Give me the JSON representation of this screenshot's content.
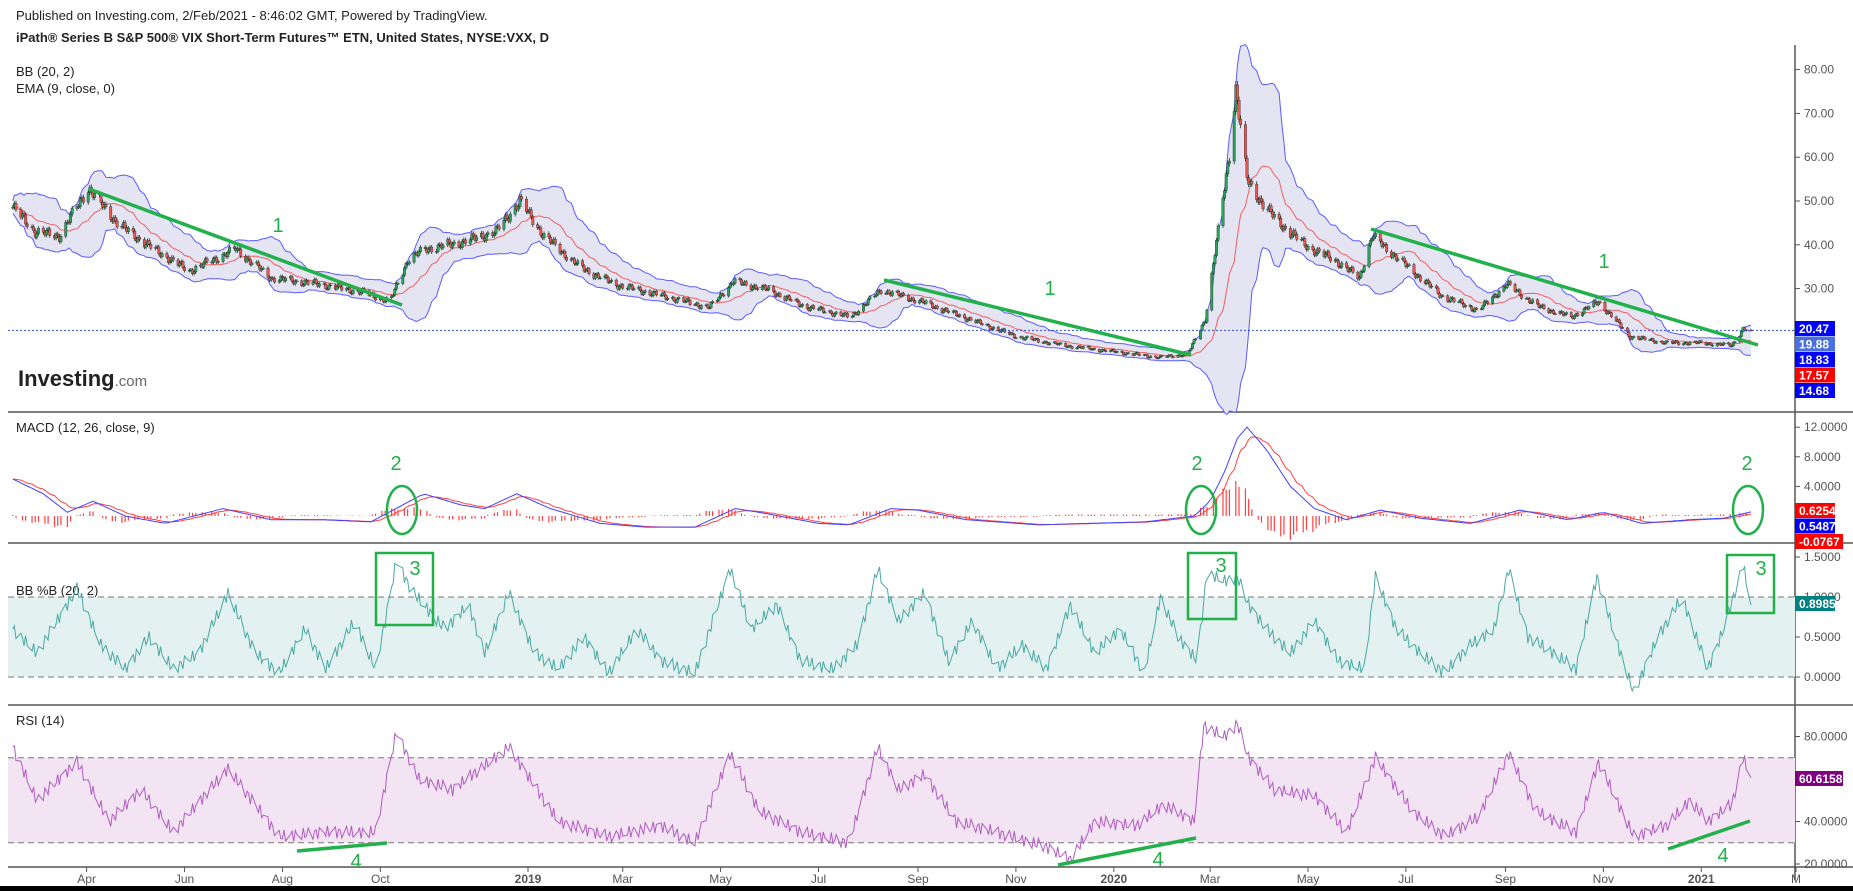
{
  "header": {
    "published": "Published on Investing.com, 2/Feb/2021 - 8:46:02 GMT, Powered by TradingView.",
    "title": "iPath® Series B S&P 500® VIX Short-Term Futures™ ETN, United States, NYSE:VXX, D"
  },
  "logo": {
    "main": "Investing",
    "suffix": ".com"
  },
  "colors": {
    "up": "#26a65b",
    "down": "#ef5350",
    "band": "#5b5bff",
    "bandFill": "#e4e4f3",
    "ema": "#f06060",
    "macd": "#4040ff",
    "signal": "#ff4040",
    "pctb": "#4aa8a4",
    "pctbFill": "#e3f1f0",
    "rsi": "#b05cc0",
    "rsiFill": "#f2e4f2",
    "annot": "#22b04a"
  },
  "chart_data": [
    {
      "type": "candlestick",
      "title": "Price",
      "legend": [
        "BB (20, 2)",
        "EMA (9, close, 0)"
      ],
      "ylim": [
        0,
        85
      ],
      "yticks": [
        30,
        40,
        50,
        60,
        70,
        80
      ],
      "ytick_labels": [
        "30.00",
        "40.00",
        "50.00",
        "60.00",
        "70.00",
        "80.00"
      ],
      "last_values": [
        {
          "label": "20.47",
          "color": "#0000ff"
        },
        {
          "label": "19.88",
          "color": "#4a6fe0"
        },
        {
          "label": "18.83",
          "color": "#0000ff"
        },
        {
          "label": "17.57",
          "color": "#ff0000"
        },
        {
          "label": "14.68",
          "color": "#0000ff"
        }
      ],
      "current_price": 20.47,
      "close_anchors": [
        [
          "2018-02-14",
          48.6
        ],
        [
          "2018-02-28",
          43
        ],
        [
          "2018-03-15",
          42
        ],
        [
          "2018-04-02",
          53
        ],
        [
          "2018-04-21",
          44.6
        ],
        [
          "2018-05-13",
          39
        ],
        [
          "2018-06-04",
          34
        ],
        [
          "2018-07-03",
          39
        ],
        [
          "2018-07-25",
          32.4
        ],
        [
          "2018-08-24",
          31
        ],
        [
          "2018-09-22",
          29
        ],
        [
          "2018-10-07",
          27
        ],
        [
          "2018-10-18",
          36.5
        ],
        [
          "2018-10-29",
          39
        ],
        [
          "2018-11-20",
          40.5
        ],
        [
          "2018-12-12",
          43
        ],
        [
          "2018-12-27",
          50
        ],
        [
          "2019-01-11",
          42
        ],
        [
          "2019-02-02",
          35
        ],
        [
          "2019-02-24",
          31
        ],
        [
          "2019-03-25",
          28.4
        ],
        [
          "2019-04-24",
          25.7
        ],
        [
          "2019-05-09",
          31.6
        ],
        [
          "2019-05-31",
          29.7
        ],
        [
          "2019-06-22",
          26
        ],
        [
          "2019-07-21",
          23.5
        ],
        [
          "2019-08-09",
          29.7
        ],
        [
          "2019-09-03",
          27
        ],
        [
          "2019-10-03",
          23
        ],
        [
          "2019-11-02",
          19
        ],
        [
          "2019-12-01",
          17
        ],
        [
          "2019-12-30",
          15.7
        ],
        [
          "2020-01-29",
          14.3
        ],
        [
          "2020-02-16",
          15
        ],
        [
          "2020-02-27",
          23
        ],
        [
          "2020-03-05",
          40.5
        ],
        [
          "2020-03-13",
          60.8
        ],
        [
          "2020-03-17",
          75.7
        ],
        [
          "2020-03-24",
          55
        ],
        [
          "2020-04-04",
          48.6
        ],
        [
          "2020-04-19",
          43
        ],
        [
          "2020-05-03",
          39
        ],
        [
          "2020-05-18",
          36.5
        ],
        [
          "2020-06-02",
          32.4
        ],
        [
          "2020-06-10",
          42
        ],
        [
          "2020-07-02",
          35
        ],
        [
          "2020-07-23",
          28.4
        ],
        [
          "2020-08-15",
          25
        ],
        [
          "2020-09-02",
          31
        ],
        [
          "2020-09-21",
          26
        ],
        [
          "2020-10-12",
          23.5
        ],
        [
          "2020-10-29",
          27
        ],
        [
          "2020-11-18",
          19
        ],
        [
          "2020-12-11",
          17.6
        ],
        [
          "2021-01-01",
          17.6
        ],
        [
          "2021-01-20",
          17
        ],
        [
          "2021-01-27",
          20.8
        ],
        [
          "2021-02-01",
          20.47
        ]
      ]
    },
    {
      "type": "line",
      "title": "MACD (12, 26, close, 9)",
      "ylim": [
        -1.6,
        13
      ],
      "yticks": [
        4,
        8,
        12
      ],
      "ytick_labels": [
        "4.0000",
        "8.0000",
        "12.0000"
      ],
      "last_values": [
        {
          "label": "0.6254",
          "color": "#ff0000"
        },
        {
          "label": "0.5487",
          "color": "#0000ff"
        },
        {
          "label": "-0.0767",
          "color": "#ff0000"
        }
      ],
      "macd_anchors": [
        [
          "2018-02-14",
          5
        ],
        [
          "2018-03-05",
          3
        ],
        [
          "2018-03-20",
          0.5
        ],
        [
          "2018-04-05",
          2
        ],
        [
          "2018-04-25",
          0
        ],
        [
          "2018-05-20",
          -1
        ],
        [
          "2018-06-25",
          1
        ],
        [
          "2018-07-25",
          -0.5
        ],
        [
          "2018-08-25",
          -0.5
        ],
        [
          "2018-09-25",
          -0.8
        ],
        [
          "2018-10-15",
          1.5
        ],
        [
          "2018-10-28",
          3
        ],
        [
          "2018-11-20",
          1.5
        ],
        [
          "2018-12-05",
          1
        ],
        [
          "2018-12-25",
          3
        ],
        [
          "2019-01-15",
          1
        ],
        [
          "2019-02-15",
          -1
        ],
        [
          "2019-03-15",
          -1.5
        ],
        [
          "2019-04-15",
          -1.5
        ],
        [
          "2019-05-10",
          1
        ],
        [
          "2019-05-25",
          0.5
        ],
        [
          "2019-07-01",
          -1
        ],
        [
          "2019-07-20",
          -1.2
        ],
        [
          "2019-08-15",
          1
        ],
        [
          "2019-09-01",
          0.8
        ],
        [
          "2019-10-01",
          -0.5
        ],
        [
          "2019-11-15",
          -1.2
        ],
        [
          "2019-12-15",
          -1
        ],
        [
          "2020-01-20",
          -0.8
        ],
        [
          "2020-02-20",
          0
        ],
        [
          "2020-03-01",
          2
        ],
        [
          "2020-03-10",
          6
        ],
        [
          "2020-03-18",
          10.5
        ],
        [
          "2020-03-24",
          12
        ],
        [
          "2020-04-05",
          9
        ],
        [
          "2020-04-20",
          4
        ],
        [
          "2020-05-05",
          1
        ],
        [
          "2020-05-25",
          -0.5
        ],
        [
          "2020-06-15",
          0.8
        ],
        [
          "2020-07-10",
          -0.3
        ],
        [
          "2020-08-10",
          -1
        ],
        [
          "2020-09-10",
          0.8
        ],
        [
          "2020-10-10",
          -0.5
        ],
        [
          "2020-11-01",
          0.5
        ],
        [
          "2020-11-25",
          -1
        ],
        [
          "2020-12-25",
          -0.5
        ],
        [
          "2021-01-15",
          -0.3
        ],
        [
          "2021-02-01",
          0.5487
        ]
      ]
    },
    {
      "type": "line",
      "title": "BB %B (20, 2)",
      "ylim": [
        -0.35,
        1.75
      ],
      "yticks": [
        0,
        0.5,
        1,
        1.5
      ],
      "ytick_labels": [
        "0.0000",
        "0.5000",
        "1.0000",
        "1.5000"
      ],
      "bands": [
        0,
        1
      ],
      "last_values": [
        {
          "label": "0.8985",
          "color": "#00807f"
        }
      ],
      "values": [
        [
          "2018-02-14",
          0.6
        ],
        [
          "2018-03-01",
          0.3
        ],
        [
          "2018-03-26",
          1.1
        ],
        [
          "2018-04-10",
          0.4
        ],
        [
          "2018-04-25",
          0.1
        ],
        [
          "2018-05-10",
          0.5
        ],
        [
          "2018-05-25",
          0.1
        ],
        [
          "2018-06-10",
          0.3
        ],
        [
          "2018-06-28",
          1.05
        ],
        [
          "2018-07-15",
          0.3
        ],
        [
          "2018-07-30",
          0.05
        ],
        [
          "2018-08-15",
          0.6
        ],
        [
          "2018-08-28",
          0.1
        ],
        [
          "2018-09-15",
          0.7
        ],
        [
          "2018-09-28",
          0.1
        ],
        [
          "2018-10-05",
          0.8
        ],
        [
          "2018-10-11",
          1.45
        ],
        [
          "2018-10-20",
          1.1
        ],
        [
          "2018-10-28",
          0.9
        ],
        [
          "2018-11-10",
          0.6
        ],
        [
          "2018-11-25",
          0.9
        ],
        [
          "2018-12-05",
          0.3
        ],
        [
          "2018-12-20",
          1.05
        ],
        [
          "2019-01-05",
          0.3
        ],
        [
          "2019-01-20",
          0.1
        ],
        [
          "2019-02-05",
          0.5
        ],
        [
          "2019-02-20",
          0.05
        ],
        [
          "2019-03-10",
          0.6
        ],
        [
          "2019-03-25",
          0.2
        ],
        [
          "2019-04-15",
          0.05
        ],
        [
          "2019-05-07",
          1.35
        ],
        [
          "2019-05-20",
          0.6
        ],
        [
          "2019-06-05",
          0.9
        ],
        [
          "2019-06-20",
          0.2
        ],
        [
          "2019-07-10",
          0.1
        ],
        [
          "2019-07-25",
          0.4
        ],
        [
          "2019-08-07",
          1.35
        ],
        [
          "2019-08-20",
          0.7
        ],
        [
          "2019-09-05",
          1.05
        ],
        [
          "2019-09-20",
          0.2
        ],
        [
          "2019-10-05",
          0.7
        ],
        [
          "2019-10-20",
          0.1
        ],
        [
          "2019-11-05",
          0.4
        ],
        [
          "2019-11-20",
          0.1
        ],
        [
          "2019-12-05",
          0.9
        ],
        [
          "2019-12-20",
          0.3
        ],
        [
          "2020-01-05",
          0.6
        ],
        [
          "2020-01-20",
          0.05
        ],
        [
          "2020-01-30",
          1.0
        ],
        [
          "2020-02-10",
          0.5
        ],
        [
          "2020-02-22",
          0.2
        ],
        [
          "2020-02-28",
          1.3
        ],
        [
          "2020-03-10",
          1.2
        ],
        [
          "2020-03-18",
          1.25
        ],
        [
          "2020-03-25",
          0.9
        ],
        [
          "2020-04-05",
          0.6
        ],
        [
          "2020-04-20",
          0.3
        ],
        [
          "2020-05-05",
          0.7
        ],
        [
          "2020-05-20",
          0.2
        ],
        [
          "2020-06-05",
          0.1
        ],
        [
          "2020-06-12",
          1.25
        ],
        [
          "2020-06-25",
          0.6
        ],
        [
          "2020-07-10",
          0.3
        ],
        [
          "2020-07-25",
          0.05
        ],
        [
          "2020-08-10",
          0.4
        ],
        [
          "2020-08-25",
          0.6
        ],
        [
          "2020-09-03",
          1.35
        ],
        [
          "2020-09-15",
          0.5
        ],
        [
          "2020-10-01",
          0.3
        ],
        [
          "2020-10-15",
          0.1
        ],
        [
          "2020-10-28",
          1.25
        ],
        [
          "2020-11-10",
          0.4
        ],
        [
          "2020-11-20",
          -0.2
        ],
        [
          "2020-12-05",
          0.5
        ],
        [
          "2020-12-20",
          1.0
        ],
        [
          "2021-01-05",
          0.1
        ],
        [
          "2021-01-15",
          0.6
        ],
        [
          "2021-01-27",
          1.4
        ],
        [
          "2021-02-01",
          0.8985
        ]
      ]
    },
    {
      "type": "line",
      "title": "RSI (14)",
      "ylim": [
        18,
        100
      ],
      "yticks": [
        20,
        40,
        80
      ],
      "ytick_labels": [
        "20.0000",
        "40.0000",
        "80.0000"
      ],
      "bands": [
        30,
        70
      ],
      "last_values": [
        {
          "label": "60.6158",
          "color": "#800080"
        }
      ],
      "values": [
        [
          "2018-02-14",
          75
        ],
        [
          "2018-03-01",
          50
        ],
        [
          "2018-03-26",
          68
        ],
        [
          "2018-04-15",
          40
        ],
        [
          "2018-05-05",
          55
        ],
        [
          "2018-05-25",
          35
        ],
        [
          "2018-06-28",
          65
        ],
        [
          "2018-07-30",
          33
        ],
        [
          "2018-08-28",
          35
        ],
        [
          "2018-09-28",
          35
        ],
        [
          "2018-10-11",
          82
        ],
        [
          "2018-10-25",
          60
        ],
        [
          "2018-11-15",
          55
        ],
        [
          "2018-12-20",
          75
        ],
        [
          "2019-01-20",
          40
        ],
        [
          "2019-02-20",
          33
        ],
        [
          "2019-03-25",
          38
        ],
        [
          "2019-04-15",
          30
        ],
        [
          "2019-05-07",
          72
        ],
        [
          "2019-05-25",
          45
        ],
        [
          "2019-06-20",
          35
        ],
        [
          "2019-07-20",
          30
        ],
        [
          "2019-08-07",
          75
        ],
        [
          "2019-08-20",
          55
        ],
        [
          "2019-09-05",
          62
        ],
        [
          "2019-09-25",
          40
        ],
        [
          "2019-10-20",
          35
        ],
        [
          "2019-11-20",
          28
        ],
        [
          "2019-12-05",
          22
        ],
        [
          "2019-12-20",
          40
        ],
        [
          "2020-01-15",
          38
        ],
        [
          "2020-02-01",
          48
        ],
        [
          "2020-02-20",
          40
        ],
        [
          "2020-02-26",
          85
        ],
        [
          "2020-03-10",
          80
        ],
        [
          "2020-03-18",
          86
        ],
        [
          "2020-03-25",
          70
        ],
        [
          "2020-04-10",
          55
        ],
        [
          "2020-05-05",
          52
        ],
        [
          "2020-05-25",
          35
        ],
        [
          "2020-06-12",
          70
        ],
        [
          "2020-07-05",
          45
        ],
        [
          "2020-07-25",
          33
        ],
        [
          "2020-08-15",
          42
        ],
        [
          "2020-09-03",
          72
        ],
        [
          "2020-09-20",
          45
        ],
        [
          "2020-10-15",
          35
        ],
        [
          "2020-10-29",
          68
        ],
        [
          "2020-11-20",
          33
        ],
        [
          "2020-12-10",
          38
        ],
        [
          "2020-12-25",
          50
        ],
        [
          "2021-01-05",
          40
        ],
        [
          "2021-01-20",
          48
        ],
        [
          "2021-01-27",
          70
        ],
        [
          "2021-02-01",
          60.6158
        ]
      ]
    }
  ],
  "x_axis": {
    "ticks": [
      [
        "2018-04-01",
        "Apr"
      ],
      [
        "2018-06-01",
        "Jun"
      ],
      [
        "2018-08-01",
        "Aug"
      ],
      [
        "2018-10-01",
        "Oct"
      ],
      [
        "2019-01-01",
        "2019"
      ],
      [
        "2019-03-01",
        "Mar"
      ],
      [
        "2019-05-01",
        "May"
      ],
      [
        "2019-07-01",
        "Jul"
      ],
      [
        "2019-09-01",
        "Sep"
      ],
      [
        "2019-11-01",
        "Nov"
      ],
      [
        "2020-01-01",
        "2020"
      ],
      [
        "2020-03-01",
        "Mar"
      ],
      [
        "2020-05-01",
        "May"
      ],
      [
        "2020-07-01",
        "Jul"
      ],
      [
        "2020-09-01",
        "Sep"
      ],
      [
        "2020-11-01",
        "Nov"
      ],
      [
        "2021-01-01",
        "2021"
      ],
      [
        "2021-03-01",
        "M"
      ]
    ]
  },
  "annotations": {
    "trend": "1",
    "macd_cross": "2",
    "pctb_break": "3",
    "rsi_divergence": "4"
  }
}
